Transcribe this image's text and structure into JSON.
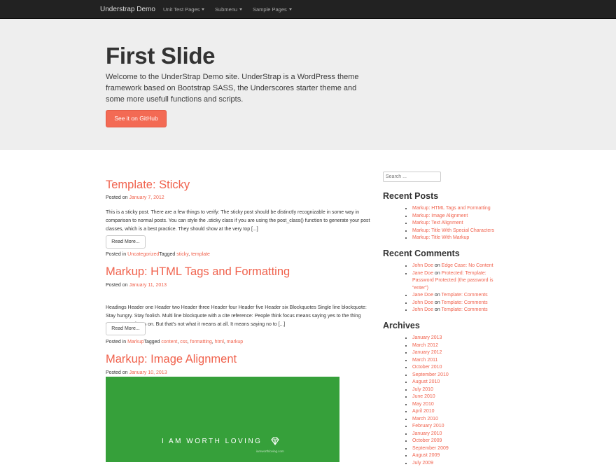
{
  "navbar": {
    "brand": "Understrap Demo",
    "menu": [
      "Unit Test Pages",
      "Submenu",
      "Sample Pages"
    ]
  },
  "hero": {
    "title": "First Slide",
    "text": "Welcome to the UnderStrap Demo site. UnderStrap is a WordPress theme framework based on Bootstrap SASS, the Underscores starter theme and some more usefull functions and scripts.",
    "button": "See it on GitHub"
  },
  "posts": [
    {
      "title": "Template: Sticky",
      "posted_on": "Posted on",
      "date": "January 7, 2012",
      "excerpt": "This is a sticky post. There are a few things to verify: The sticky post should be distinctly recognizable in some way in comparison to normal posts. You can style the .sticky class if you are using the post_class() function to generate your post classes, which is a best practice. They should show at the very top [...]",
      "read_more": "Read More...",
      "posted_in": "Posted in",
      "category": "Uncategorized",
      "tagged": "Tagged",
      "tags": [
        "sticky",
        "template"
      ]
    },
    {
      "title": "Markup: HTML Tags and Formatting",
      "posted_on": "Posted on",
      "date": "January 11, 2013",
      "excerpt": "Headings Header one Header two Header three Header four Header five Header six Blockquotes Single line blockquote: Stay hungry. Stay foolish. Multi line blockquote with a cite reference: People think focus means saying yes to the thing you've got to focus on. But that's not what it means at all. It means saying no to [...]",
      "read_more": "Read More...",
      "posted_in": "Posted in",
      "category": "Markup",
      "tagged": "Tagged",
      "tags": [
        "content",
        "css",
        "formatting",
        "html",
        "markup"
      ]
    },
    {
      "title": "Markup: Image Alignment",
      "posted_on": "Posted on",
      "date": "January 10, 2013",
      "image_text": "I AM WORTH LOVING",
      "image_sub": "iamworthloving.com"
    }
  ],
  "sidebar": {
    "search_placeholder": "Search ...",
    "recent_posts_title": "Recent Posts",
    "recent_posts": [
      "Markup: HTML Tags and Formatting",
      "Markup: Image Alignment",
      "Markup: Text Alignment",
      "Markup: Title With Special Characters",
      "Markup: Title With Markup"
    ],
    "recent_comments_title": "Recent Comments",
    "on_word": "on",
    "recent_comments": [
      {
        "author": "John Doe",
        "post": "Edge Case: No Content"
      },
      {
        "author": "Jane Doe",
        "post": "Protected: Template: Password Protected (the password is “enter”)"
      },
      {
        "author": "Jane Doe",
        "post": "Template: Comments"
      },
      {
        "author": "John Doe",
        "post": "Template: Comments"
      },
      {
        "author": "John Doe",
        "post": "Template: Comments"
      }
    ],
    "archives_title": "Archives",
    "archives": [
      "January 2013",
      "March 2012",
      "January 2012",
      "March 2011",
      "October 2010",
      "September 2010",
      "August 2010",
      "July 2010",
      "June 2010",
      "May 2010",
      "April 2010",
      "March 2010",
      "February 2010",
      "January 2010",
      "October 2009",
      "September 2009",
      "August 2009",
      "July 2009"
    ]
  },
  "colors": {
    "accent": "#f0624d",
    "navbar_bg": "#222222",
    "hero_bg": "#eeeeee",
    "image_bg": "#36a03a"
  }
}
